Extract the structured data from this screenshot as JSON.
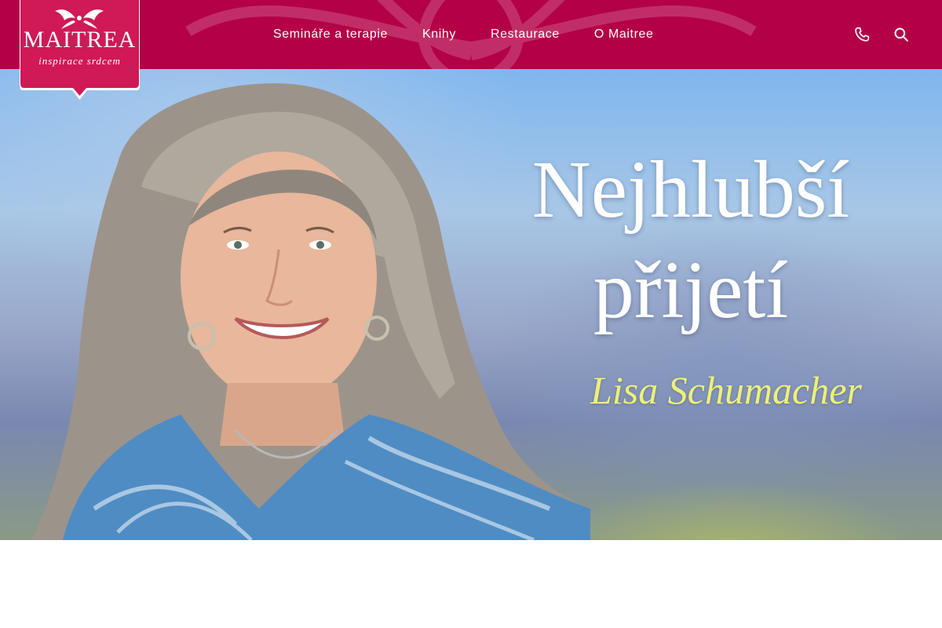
{
  "logo": {
    "name": "MAITREA",
    "tagline": "inspirace srdcem"
  },
  "nav": {
    "items": [
      {
        "label": "Semináře a terapie"
      },
      {
        "label": "Knihy"
      },
      {
        "label": "Restaurace"
      },
      {
        "label": "O Maitree"
      }
    ]
  },
  "header_icons": {
    "phone": "phone-icon",
    "search": "search-icon"
  },
  "hero": {
    "title_line1": "Nejhlubší",
    "title_line2": "přijetí",
    "author": "Lisa Schumacher"
  },
  "colors": {
    "brand": "#b40046",
    "title": "#ffffff",
    "author": "#eef07a"
  }
}
